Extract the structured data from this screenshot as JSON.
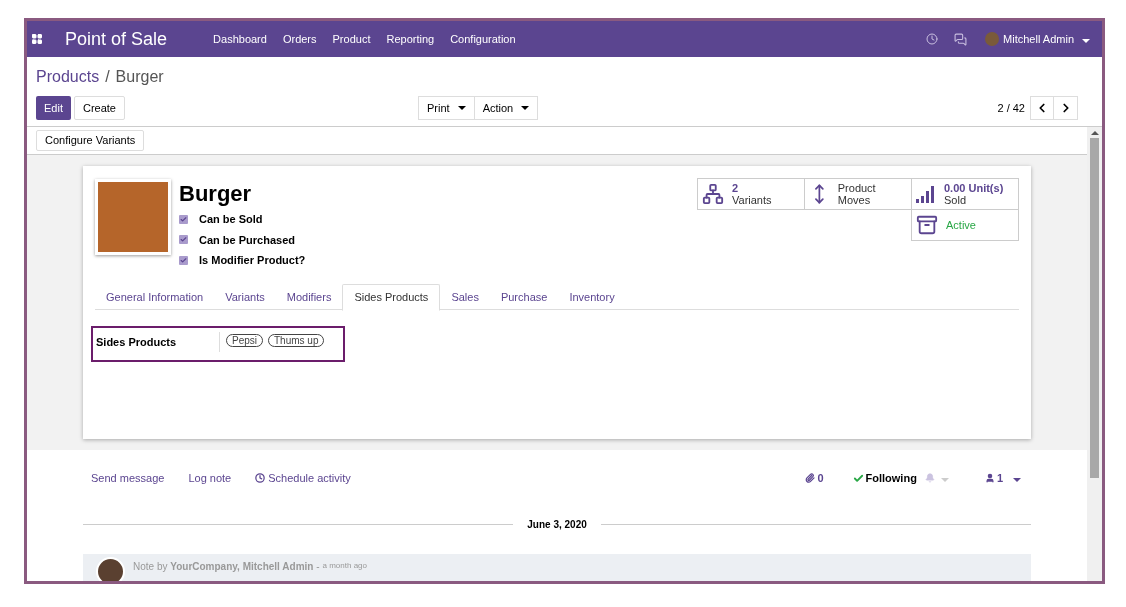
{
  "navbar": {
    "app_title": "Point of Sale",
    "menu": [
      "Dashboard",
      "Orders",
      "Product",
      "Reporting",
      "Configuration"
    ],
    "user": "Mitchell Admin"
  },
  "breadcrumb": {
    "parent": "Products",
    "separator": "/",
    "current": "Burger"
  },
  "buttons": {
    "edit": "Edit",
    "create": "Create",
    "dropdowns": [
      "Print",
      "Action"
    ],
    "pager": "2 / 42"
  },
  "configure_button": "Configure Variants",
  "product": {
    "name": "Burger",
    "options": [
      {
        "label": "Can be Sold",
        "checked": true
      },
      {
        "label": "Can be Purchased",
        "checked": true
      },
      {
        "label": "Is Modifier Product?",
        "checked": true
      }
    ]
  },
  "stat_buttons": [
    {
      "kind": "variants",
      "value": "2",
      "label": "Variants"
    },
    {
      "kind": "moves",
      "label": "Product Moves"
    },
    {
      "kind": "sold",
      "value": "0.00 Unit(s)",
      "label": "Sold"
    },
    {
      "kind": "active",
      "label": "Active"
    }
  ],
  "tabs": [
    {
      "label": "General Information",
      "selected": false
    },
    {
      "label": "Variants",
      "selected": false
    },
    {
      "label": "Modifiers",
      "selected": false
    },
    {
      "label": "Sides Products",
      "selected": true
    },
    {
      "label": "Sales",
      "selected": false
    },
    {
      "label": "Purchase",
      "selected": false
    },
    {
      "label": "Inventory",
      "selected": false
    }
  ],
  "sides_field": {
    "label": "Sides Products",
    "tags": [
      "Pepsi",
      "Thums up"
    ]
  },
  "chatter": {
    "actions": [
      {
        "kind": "plain",
        "label": "Send message"
      },
      {
        "kind": "plain",
        "label": "Log note"
      },
      {
        "kind": "clock",
        "label": "Schedule activity"
      }
    ],
    "attachments": "0",
    "following": "Following",
    "followers": "1",
    "date": "June 3, 2020",
    "message": {
      "author_line": "Note by **YourCompany, Mitchell Admin** -",
      "time": "a month ago"
    }
  }
}
